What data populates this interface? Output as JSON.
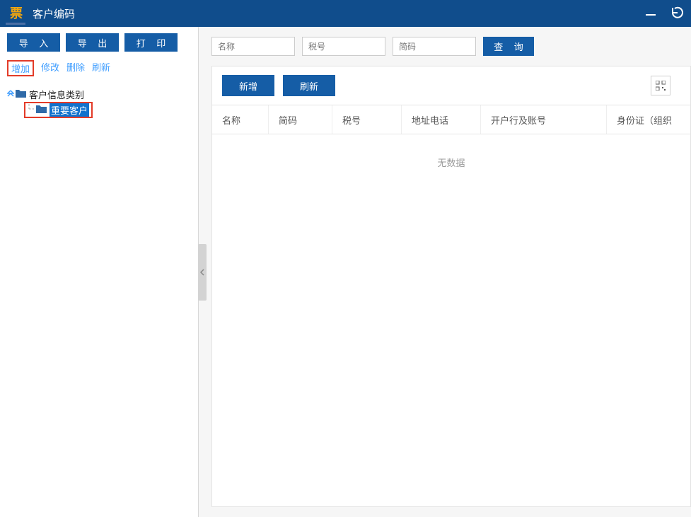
{
  "titlebar": {
    "title": "客户编码",
    "logo_text": "票"
  },
  "left": {
    "toolbar": {
      "import": "导 入",
      "export": "导 出",
      "print": "打 印"
    },
    "links": {
      "add": "增加",
      "edit": "修改",
      "delete": "删除",
      "refresh": "刷新"
    },
    "tree": {
      "root": "客户信息类别",
      "child": "重要客户"
    }
  },
  "right": {
    "search": {
      "name_placeholder": "名称",
      "tax_placeholder": "税号",
      "code_placeholder": "简码",
      "query_btn": "查 询"
    },
    "panel": {
      "add_btn": "新增",
      "refresh_btn": "刷新"
    },
    "table": {
      "columns": {
        "name": "名称",
        "code": "简码",
        "tax": "税号",
        "addr": "地址电话",
        "bank": "开户行及账号",
        "id": "身份证（组织"
      },
      "empty": "无数据"
    }
  }
}
